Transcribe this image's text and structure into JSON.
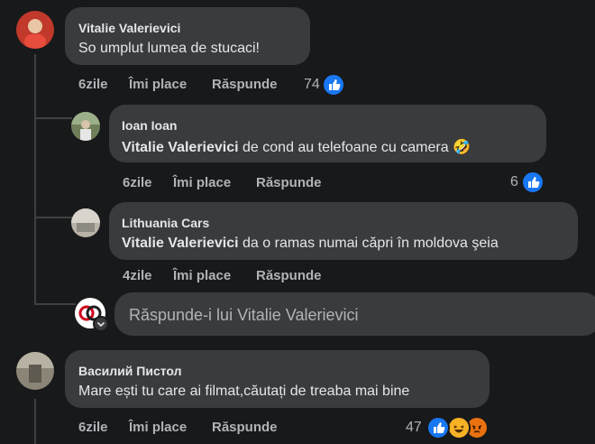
{
  "comments": [
    {
      "author": "Vitalie Valerievici",
      "text": "So umplut lumea de stucaci!",
      "time": "6zile",
      "like_label": "Îmi place",
      "reply_label": "Răspunde",
      "reaction_count": "74",
      "reactions": [
        "like-icon"
      ],
      "avatar_color": "#c0392b"
    },
    {
      "author": "Ioan Ioan",
      "mention": "Vitalie Valerievici",
      "text": " de cond au telefoane cu camera",
      "emoji": "🤣",
      "time": "6zile",
      "like_label": "Îmi place",
      "reply_label": "Răspunde",
      "reaction_count": "6",
      "reactions": [
        "like-icon"
      ],
      "avatar_color": "#6f7f5a"
    },
    {
      "author": "Lithuania Cars",
      "mention": "Vitalie Valerievici",
      "text": " da o ramas numai căpri în moldova şeia",
      "time": "4zile",
      "like_label": "Îmi place",
      "reply_label": "Răspunde",
      "avatar_color": "#b9b3a7"
    },
    {
      "author": "Василий Пистол",
      "text": "Mare ești tu care ai filmat,căutați de treaba mai bine",
      "time": "6zile",
      "like_label": "Îmi place",
      "reply_label": "Răspunde",
      "reaction_count": "47",
      "reactions": [
        "like-icon",
        "laugh-icon",
        "angry-icon"
      ],
      "avatar_color": "#8a8576"
    }
  ],
  "reply_input": {
    "placeholder": "Răspunde-i lui Vitalie Valerievici"
  },
  "colors": {
    "background": "#18191a",
    "bubble": "#3a3b3c",
    "like_blue": "#1877f2",
    "muted_text": "#b0b3b8"
  }
}
